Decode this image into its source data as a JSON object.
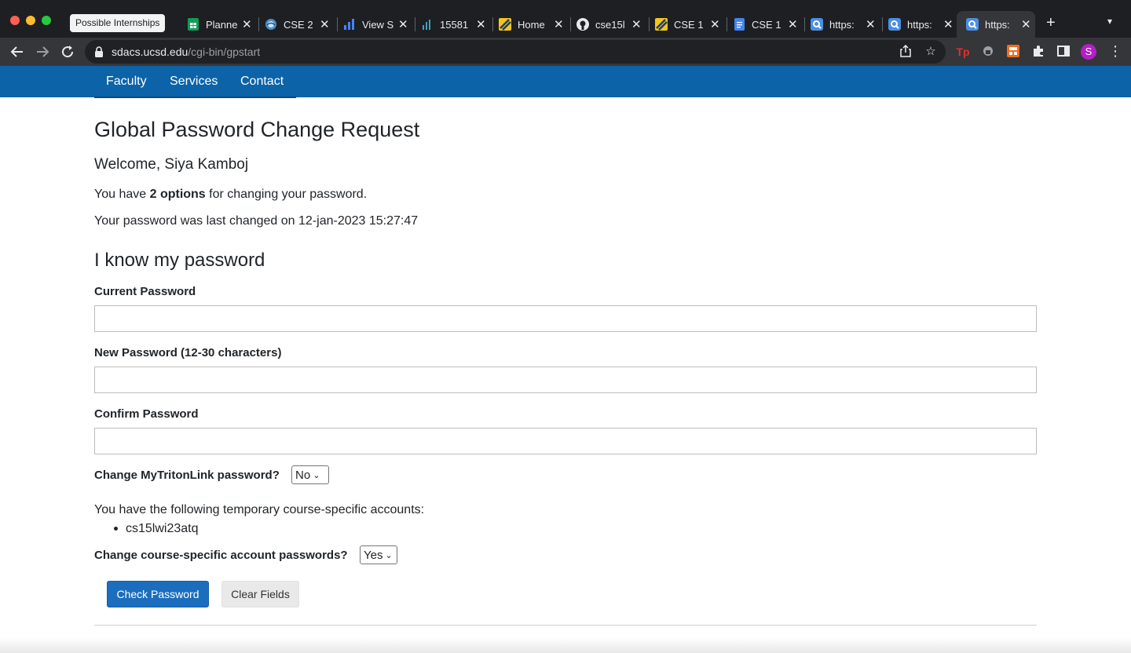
{
  "browser": {
    "tooltip": "Possible Internships",
    "tabs": [
      {
        "label": "Planne",
        "icon": "google-sheets-icon"
      },
      {
        "label": "CSE 2",
        "icon": "site-icon"
      },
      {
        "label": "View S",
        "icon": "analytics-icon"
      },
      {
        "label": "15581",
        "icon": "analytics-icon"
      },
      {
        "label": "Home",
        "icon": "canvas-icon"
      },
      {
        "label": "cse15l",
        "icon": "github-icon"
      },
      {
        "label": "CSE 1",
        "icon": "canvas-icon"
      },
      {
        "label": "CSE 1",
        "icon": "google-docs-icon"
      },
      {
        "label": "https:",
        "icon": "search-page-icon"
      },
      {
        "label": "https:",
        "icon": "search-page-icon"
      },
      {
        "label": "https:",
        "icon": "search-page-icon"
      }
    ],
    "close_glyph": "✕",
    "url_host": "sdacs.ucsd.edu",
    "url_path": "/cgi-bin/gpstart",
    "profile_initial": "S",
    "ext_label": "Tp"
  },
  "nav": {
    "items": [
      "Faculty",
      "Services",
      "Contact"
    ]
  },
  "page": {
    "title": "Global Password Change Request",
    "welcome": "Welcome, Siya Kamboj",
    "options_pre": "You have ",
    "options_bold": "2 options",
    "options_post": " for changing your password.",
    "last_changed": "Your password was last changed on 12-jan-2023 15:27:47",
    "section_title": "I know my password",
    "current_password_label": "Current Password",
    "new_password_label": "New Password (12-30 characters)",
    "confirm_password_label": "Confirm Password",
    "change_mytritonlink_label": "Change MyTritonLink password?",
    "change_mytritonlink_value": "No",
    "temp_accounts_text": "You have the following temporary course-specific accounts:",
    "temp_accounts": [
      "cs15lwi23atq"
    ],
    "change_course_label": "Change course-specific account passwords?",
    "change_course_value": "Yes",
    "check_button": "Check Password",
    "clear_button": "Clear Fields"
  },
  "colors": {
    "navbar": "#0c63a8",
    "primary_button": "#1b6ebe",
    "chrome_dark": "#1e1f22"
  }
}
